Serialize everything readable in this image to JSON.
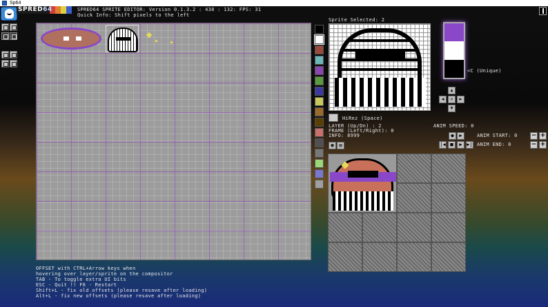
{
  "window": {
    "title": "Sp64"
  },
  "logo": {
    "text": "SPRED",
    "suffix": "64"
  },
  "header": {
    "line1": "SPRED64 SPRITE EDITOR: Version 0.1.3.2 : 438 : 132: FPS: 31",
    "line2": "Quick Info: Shift pixels to the left"
  },
  "sprite_editor": {
    "selected_label": "Sprite Selected: 2",
    "color_label": "<C  (Unique)",
    "mode_label": "HiRez (Space)",
    "layer_label": "LAYER (Up/Dn)       : 2",
    "frame_label": "FRAME (Left/Right): 0",
    "info_label": "INFO: 8999"
  },
  "palette": {
    "colors": [
      "#000000",
      "#ffffff",
      "#9a4a3a",
      "#6ab8b8",
      "#8a46b0",
      "#5a9a3a",
      "#3a3aa0",
      "#c8c85a",
      "#9a6a2a",
      "#5a4000",
      "#c8706a",
      "#505050",
      "#787878",
      "#9ad87a",
      "#7878d0",
      "#a0a0a0"
    ],
    "strip_colors": [
      "#8a48c8",
      "#ffffff",
      "#000000"
    ]
  },
  "animation": {
    "speed_label": "ANIM SPEED: 0",
    "start_label": "ANIM START: 0",
    "end_label": "ANIM END: 0"
  },
  "buttons": {
    "plus": "+",
    "minus": "−",
    "play": "▶",
    "stop": "■",
    "prev": "◀",
    "first": "|◀",
    "last": "▶|"
  },
  "dpad": {
    "up": "▲",
    "down": "▼",
    "left": "◀",
    "right": "▶",
    "center": "✕"
  },
  "help_lines": [
    "OFFSET with CTRL+Arrow keys when",
    "hovering over layer/sprite on the compositor",
    "TAB - To toggle extra UI bits",
    "ESC - Quit !! F6 - Restart",
    "Shift+L - fix old offsets (please resave after loading)",
    "Alt+L - fix new offsets (please resave after loading)"
  ],
  "icons": [
    "app-icon",
    "avatar-icon",
    "save-icon",
    "load-icon",
    "copy-icon",
    "paste-icon",
    "mode-icon",
    "close-icon"
  ]
}
